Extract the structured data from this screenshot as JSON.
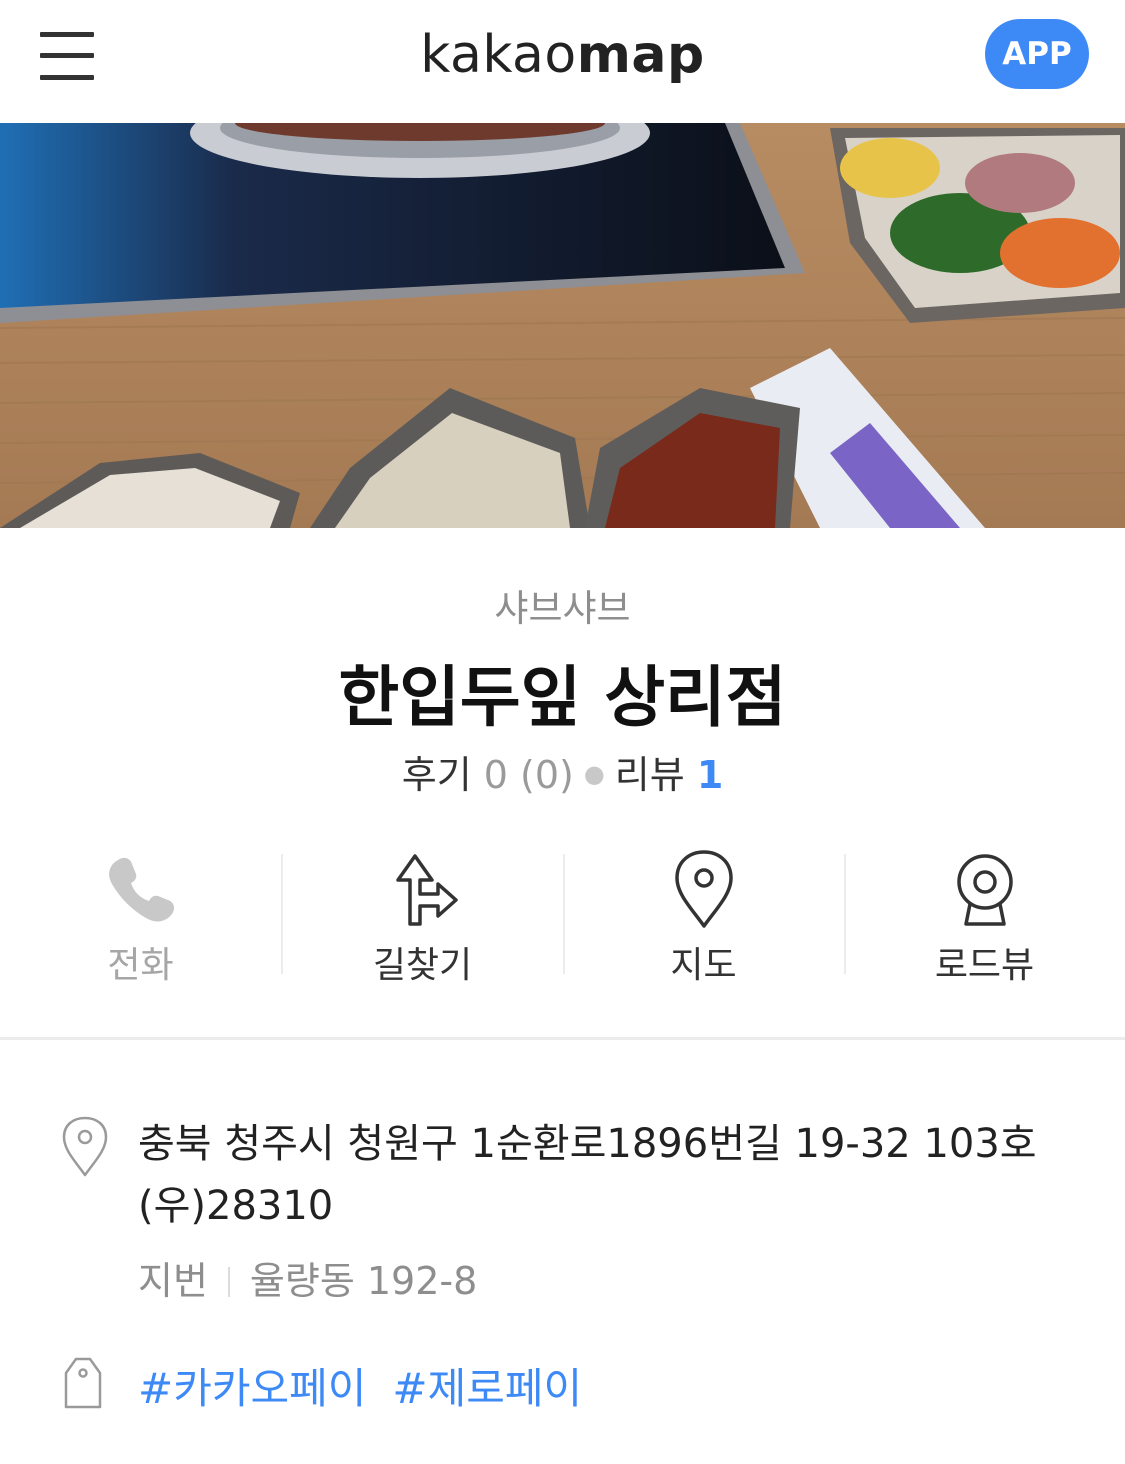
{
  "header": {
    "logo_light": "kakao",
    "logo_bold": "map",
    "app_button": "APP",
    "menu_icon": "hamburger-menu-icon"
  },
  "place": {
    "category": "샤브샤브",
    "name": "한입두잎 상리점",
    "stats": {
      "review_label": "후기",
      "review_value": "0 (0)",
      "blog_label": "리뷰",
      "blog_value": "1"
    }
  },
  "actions": [
    {
      "label": "전화",
      "icon": "phone-icon",
      "enabled": false
    },
    {
      "label": "길찾기",
      "icon": "directions-icon",
      "enabled": true
    },
    {
      "label": "지도",
      "icon": "map-pin-icon",
      "enabled": true
    },
    {
      "label": "로드뷰",
      "icon": "roadview-icon",
      "enabled": true
    }
  ],
  "info": {
    "address": "충북 청주시 청원구 1순환로1896번길 19-32 103호 (우)28310",
    "jibun_label": "지번",
    "jibun_value": "율량동 192-8",
    "tags": [
      "#카카오페이",
      "#제로페이"
    ]
  },
  "colors": {
    "accent": "#3d8af7",
    "text": "#111111",
    "muted": "#8e8e8e",
    "divider": "#ececec"
  }
}
